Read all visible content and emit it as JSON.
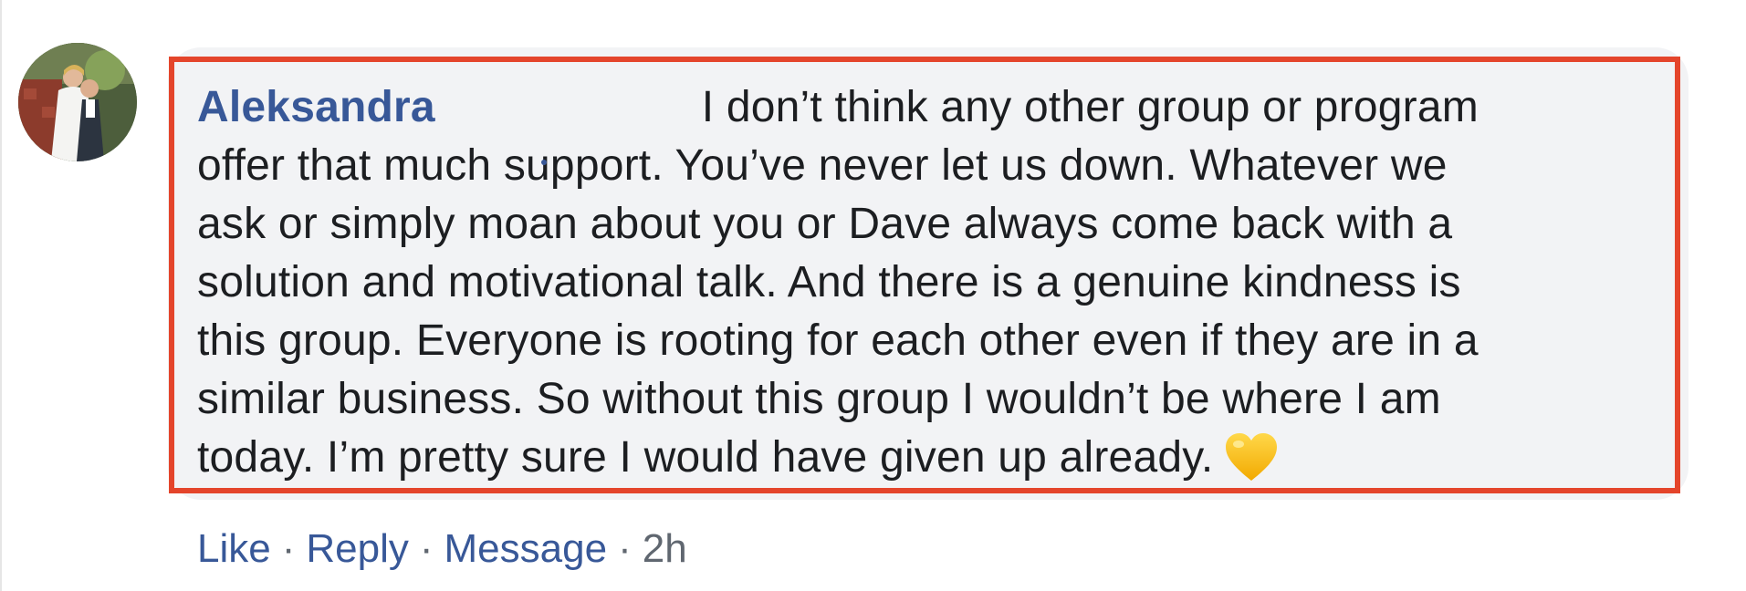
{
  "comment": {
    "author": "Aleksandra",
    "text_lines": [
      "I don’t think any other group or program",
      "offer that much support. You’ve never let us down. Whatever we",
      "ask or simply moan about you or Dave always come back with a",
      "solution and motivational talk. And there is a genuine kindness is",
      "this group. Everyone is rooting for each other even if they are in a",
      "similar business. So without this group I wouldn’t be where I am",
      "today. I’m pretty sure I would have given up already."
    ],
    "emoji": "yellow-heart-icon",
    "highlight_color": "#e4452b"
  },
  "actions": {
    "like": "Like",
    "reply": "Reply",
    "message": "Message",
    "separator": "·",
    "time": "2h"
  },
  "colors": {
    "link": "#385898",
    "text": "#1c1e21",
    "muted": "#606770",
    "bubble": "#f2f3f5"
  }
}
